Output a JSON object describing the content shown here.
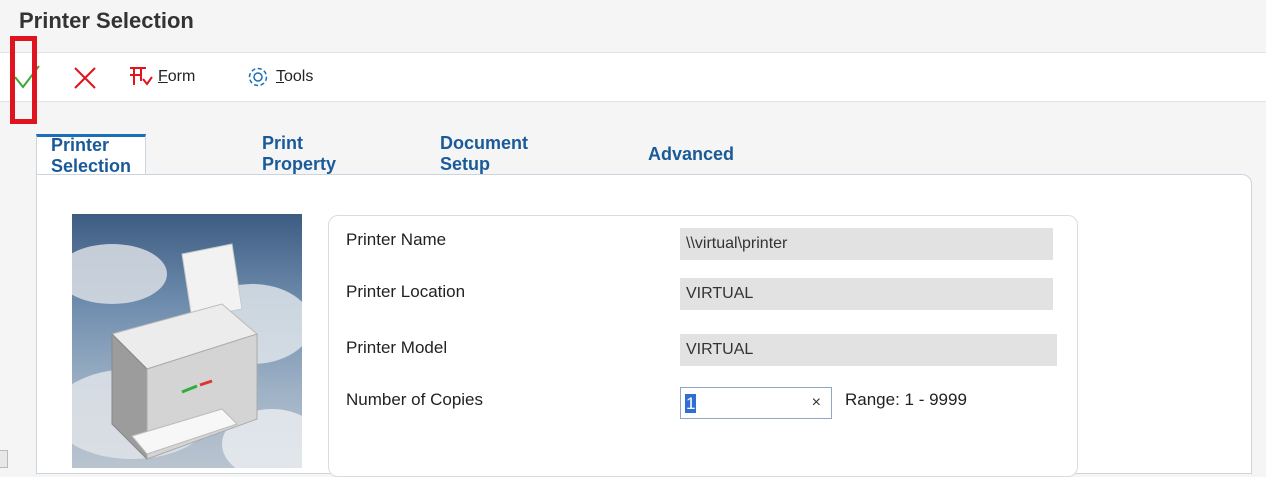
{
  "page": {
    "title": "Printer Selection"
  },
  "toolbar": {
    "ok_icon": "checkmark-icon",
    "cancel_icon": "close-icon",
    "form_icon": "form-icon",
    "form_label": "Form",
    "tools_icon": "gear-icon",
    "tools_label": "Tools",
    "ok_color": "#3aaa35",
    "cancel_color": "#e0141e",
    "highlight_color": "#e0141e"
  },
  "tabs": [
    {
      "label": "Printer Selection",
      "active": true
    },
    {
      "label": "Print Property",
      "active": false
    },
    {
      "label": "Document Setup",
      "active": false
    },
    {
      "label": "Advanced",
      "active": false
    }
  ],
  "fields": {
    "printer_name": {
      "label": "Printer Name",
      "value": "\\\\virtual\\printer"
    },
    "printer_location": {
      "label": "Printer Location",
      "value": "VIRTUAL"
    },
    "printer_model": {
      "label": "Printer Model",
      "value": "VIRTUAL"
    },
    "copies": {
      "label": "Number of Copies",
      "value": "1",
      "clear": "×",
      "range": "Range: 1 - 9999"
    }
  },
  "colors": {
    "tab_text": "#1a5a99",
    "tab_active_border": "#1a6fb8"
  }
}
